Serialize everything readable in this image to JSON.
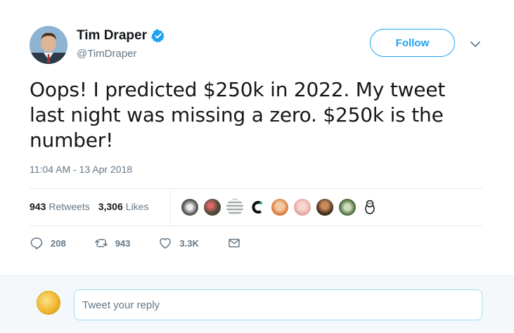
{
  "author": {
    "name": "Tim Draper",
    "handle": "@TimDraper",
    "verified": true
  },
  "follow_label": "Follow",
  "tweet_text": "Oops! I predicted $250k in 2022. My tweet last night was missing a zero. $250k is the number!",
  "timestamp": "11:04 AM - 13 Apr 2018",
  "stats": {
    "retweets_count": "943",
    "retweets_label": "Retweets",
    "likes_count": "3,306",
    "likes_label": "Likes"
  },
  "actions": {
    "replies": "208",
    "retweets": "943",
    "likes": "3.3K"
  },
  "reply": {
    "placeholder": "Tweet your reply"
  },
  "colors": {
    "accent": "#1da1f2",
    "secondary_text": "#657786"
  }
}
